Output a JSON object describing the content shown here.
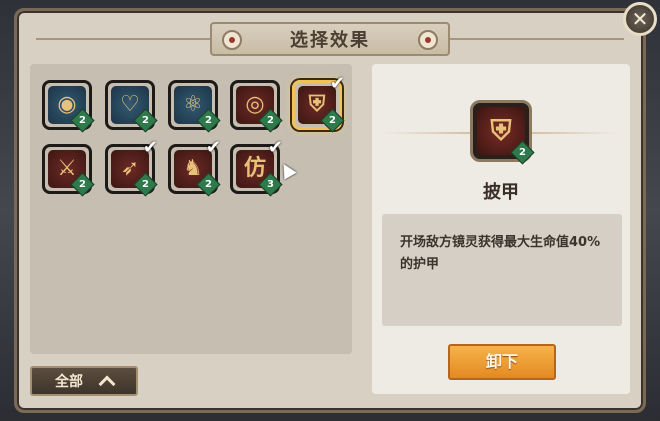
{
  "dialog": {
    "title": "选择效果",
    "close_label": "✕"
  },
  "effects": [
    {
      "icon": "turtle-shell-icon",
      "glyph": "◉",
      "level": "2",
      "theme": "blue",
      "checked": false,
      "selected": false
    },
    {
      "icon": "heart-up-icon",
      "glyph": "♡",
      "level": "2",
      "theme": "blue",
      "checked": false,
      "selected": false
    },
    {
      "icon": "atom-sword-icon",
      "glyph": "⚛",
      "level": "2",
      "theme": "blue",
      "checked": false,
      "selected": false
    },
    {
      "icon": "vortex-icon",
      "glyph": "◎",
      "level": "2",
      "theme": "red",
      "checked": false,
      "selected": false
    },
    {
      "icon": "armor-icon",
      "glyph": "⛨",
      "level": "2",
      "theme": "red",
      "checked": true,
      "selected": true
    },
    {
      "icon": "sword-up-icon",
      "glyph": "⚔",
      "level": "2",
      "theme": "red",
      "checked": false,
      "selected": false
    },
    {
      "icon": "bow-icon",
      "glyph": "➶",
      "level": "2",
      "theme": "red",
      "checked": true,
      "selected": false
    },
    {
      "icon": "beast-icon",
      "glyph": "♞",
      "level": "2",
      "theme": "red",
      "checked": true,
      "selected": false
    },
    {
      "icon": "imitate-icon",
      "glyph": "仿",
      "level": "3",
      "theme": "red",
      "checked": true,
      "selected": false
    }
  ],
  "filter": {
    "label": "全部"
  },
  "detail": {
    "name": "披甲",
    "level": "2",
    "description": "开场敌方镜灵获得最大生命值40%的护甲",
    "button_label": "卸下"
  },
  "colors": {
    "accent": "#f2c25a",
    "button": "#f0a03a",
    "badge": "#2e7a4b"
  }
}
